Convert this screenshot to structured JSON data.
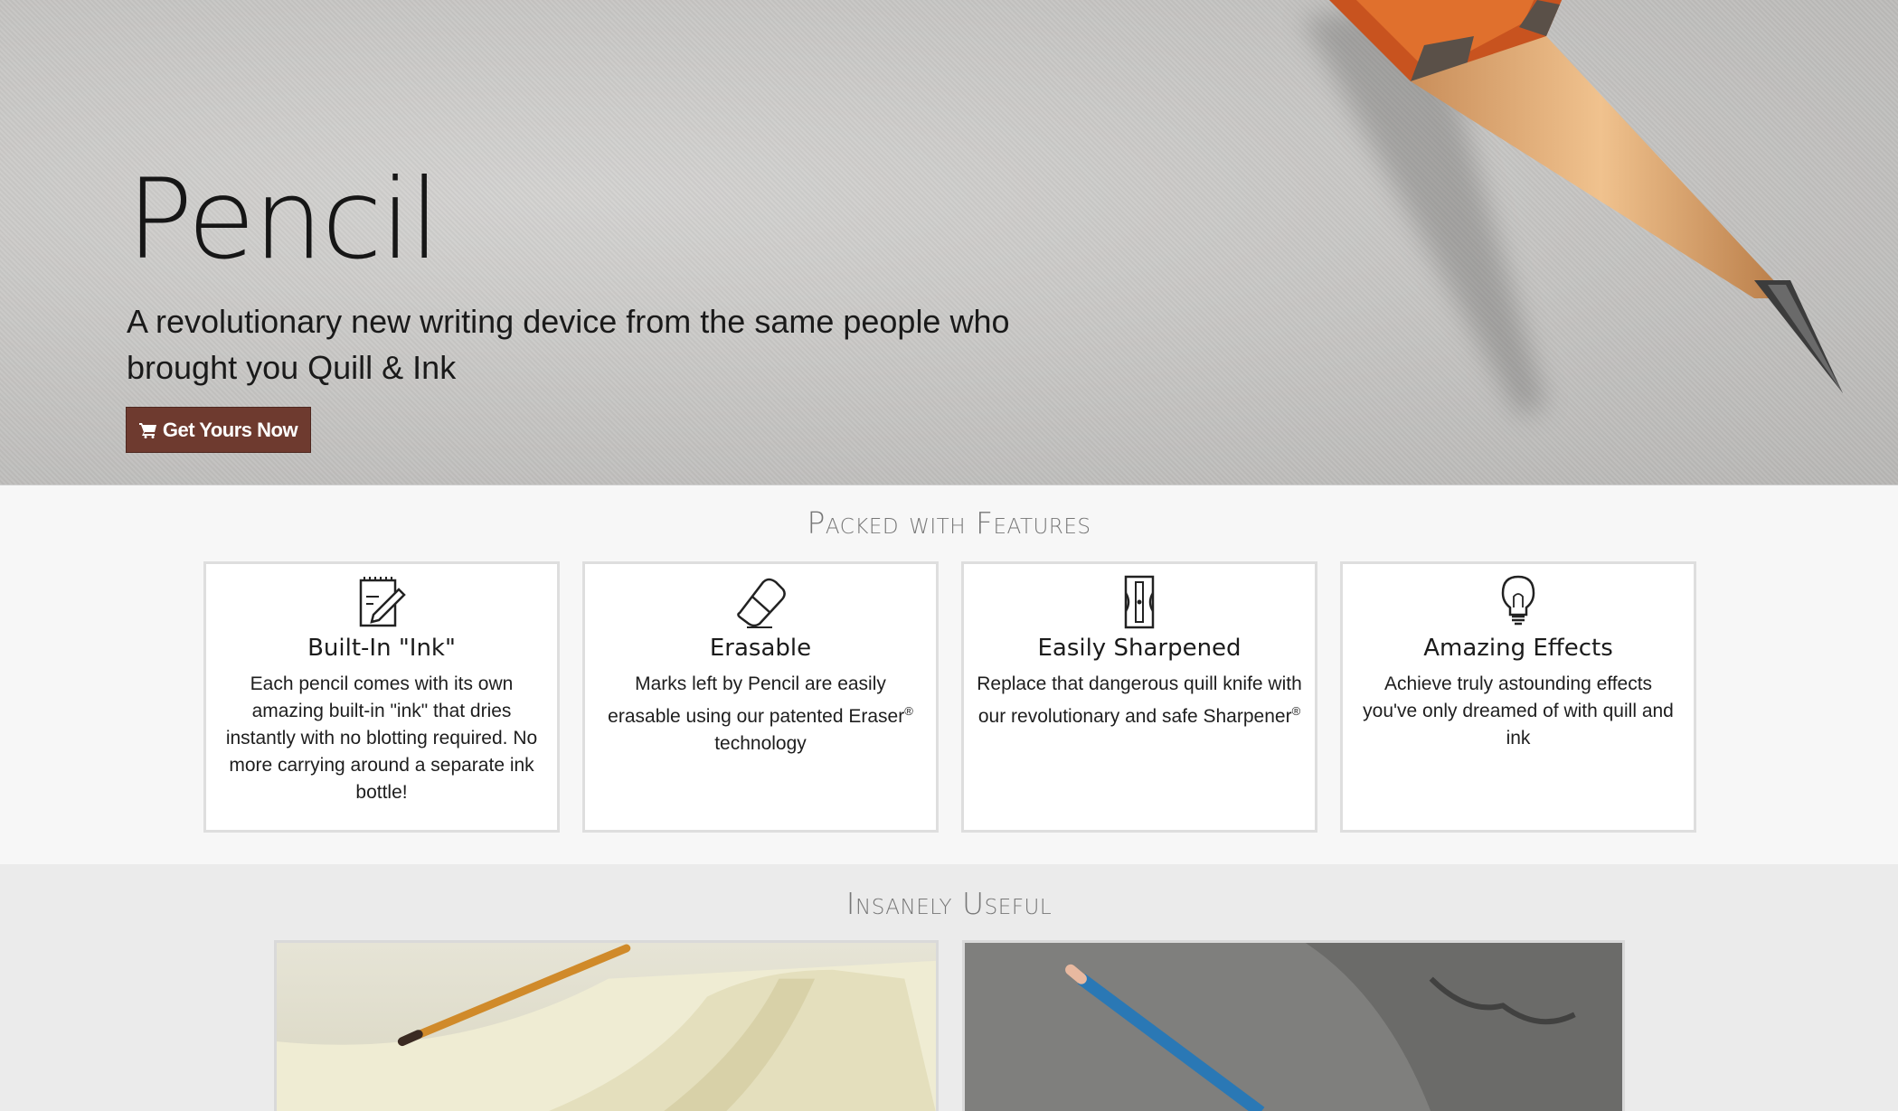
{
  "hero": {
    "title": "Pencil",
    "subtitle": "A revolutionary new writing device from the same people who brought you Quill & Ink",
    "cta_label": "Get Yours Now"
  },
  "features": {
    "heading": "Packed with Features",
    "items": [
      {
        "icon": "notepad-pencil-icon",
        "title": "Built-In \"Ink\"",
        "text": "Each pencil comes with its own amazing built-in \"ink\" that dries instantly with no blotting required. No more carrying around a separate ink bottle!"
      },
      {
        "icon": "eraser-icon",
        "title": "Erasable",
        "text": "Marks left by Pencil are easily erasable using our patented Eraser",
        "sup": "®",
        "text_after": " technology"
      },
      {
        "icon": "sharpener-icon",
        "title": "Easily Sharpened",
        "text": "Replace that dangerous quill knife with our revolutionary and safe Sharpener",
        "sup": "®",
        "text_after": ""
      },
      {
        "icon": "lightbulb-icon",
        "title": "Amazing Effects",
        "text": "Achieve truly astounding effects you've only dreamed of with quill and ink"
      }
    ]
  },
  "useful": {
    "heading": "Insanely Useful"
  },
  "colors": {
    "cta_bg": "#6e3a2f",
    "heading_gray": "#777777"
  }
}
